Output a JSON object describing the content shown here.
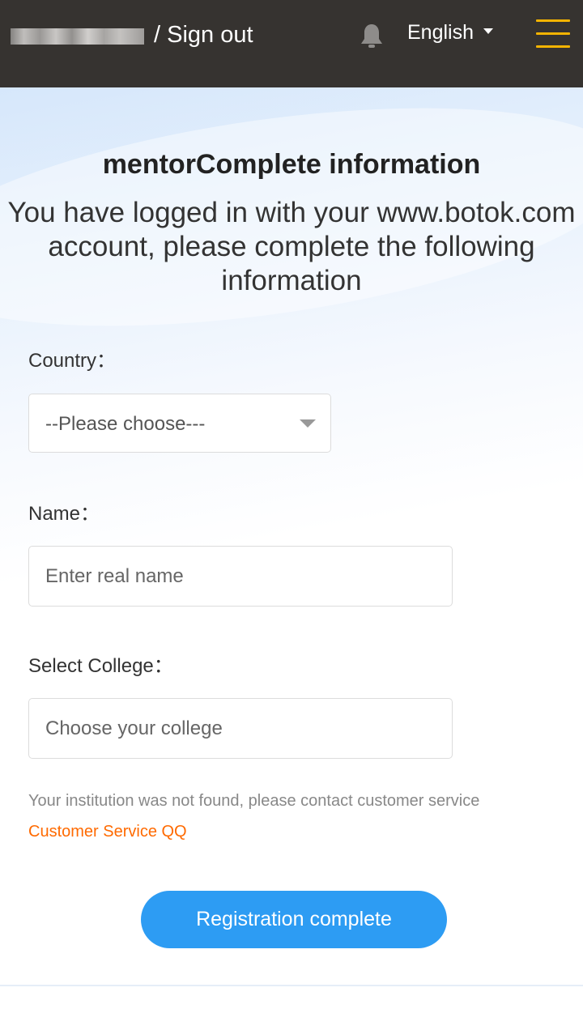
{
  "header": {
    "signout_label": "/ Sign out",
    "language_label": "English",
    "icons": {
      "notification": "bell-icon",
      "language_dropdown": "caret-down-icon",
      "menu": "hamburger-menu-icon"
    },
    "colors": {
      "background": "#363330",
      "menu_accent": "#f5b400"
    }
  },
  "main": {
    "title": "mentorComplete information",
    "subtitle": "You have logged in with your www.botok.com account, please complete the following information",
    "form": {
      "country": {
        "label": "Country：",
        "selected": "--Please choose---"
      },
      "name": {
        "label": "Name：",
        "placeholder": "Enter real name",
        "value": ""
      },
      "college": {
        "label": "Select College：",
        "placeholder": "Choose your college",
        "value": ""
      },
      "note_text": "Your institution was not found, please contact customer service",
      "note_link": "Customer Service QQ",
      "submit_label": "Registration complete"
    },
    "colors": {
      "primary_button": "#2d9cf3",
      "link": "#ff6a00"
    }
  }
}
